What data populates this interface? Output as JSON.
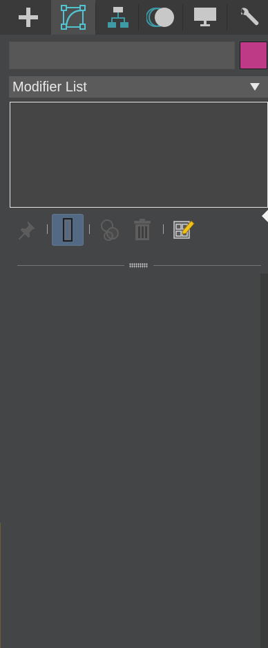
{
  "tabs": [
    {
      "id": "create",
      "icon": "plus-icon",
      "active": false
    },
    {
      "id": "modify",
      "icon": "modify-curve-icon",
      "active": true
    },
    {
      "id": "hierarchy",
      "icon": "hierarchy-icon",
      "active": false
    },
    {
      "id": "motion",
      "icon": "motion-icon",
      "active": false
    },
    {
      "id": "display",
      "icon": "display-monitor-icon",
      "active": false
    },
    {
      "id": "utilities",
      "icon": "wrench-icon",
      "active": false
    }
  ],
  "object": {
    "name": "",
    "color": "#bf3a86"
  },
  "modifier_list": {
    "label": "Modifier List"
  },
  "stack_toolbar": [
    {
      "id": "pin-stack",
      "icon": "pin-icon",
      "active": false
    },
    {
      "id": "show-end-result",
      "icon": "end-result-icon",
      "active": true
    },
    {
      "id": "make-unique",
      "icon": "make-unique-icon",
      "active": false
    },
    {
      "id": "remove-modifier",
      "icon": "trash-icon",
      "active": false
    },
    {
      "id": "configure-modifier-sets",
      "icon": "configure-sets-icon",
      "active": false
    }
  ],
  "colors": {
    "accent_teal": "#52c3d0",
    "active_tool": "#546a84",
    "panel_bg": "#444546"
  }
}
